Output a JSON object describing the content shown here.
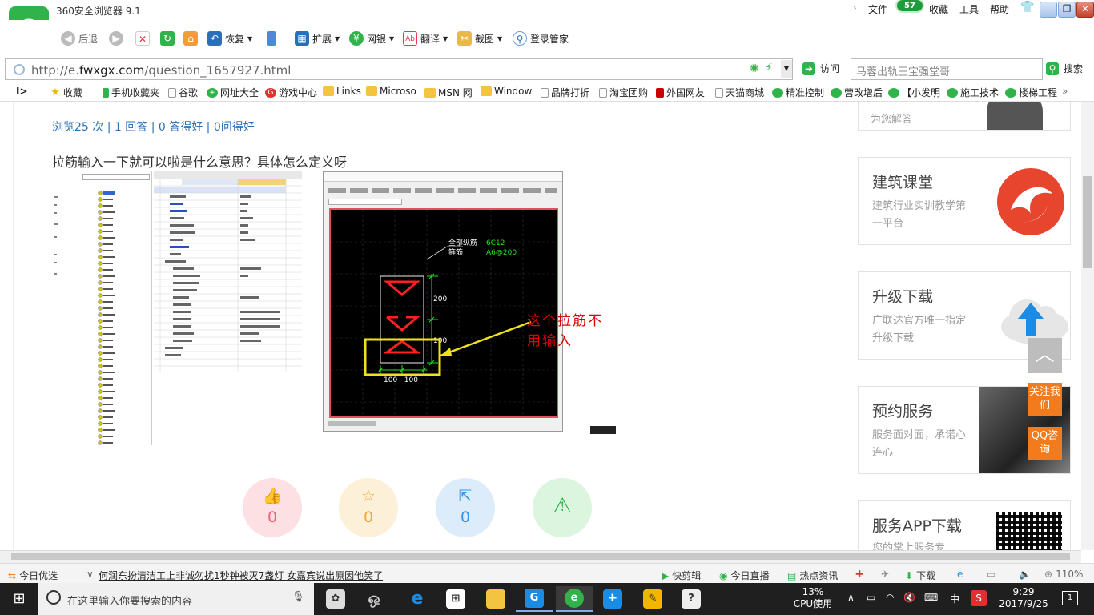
{
  "browser": {
    "title": "360安全浏览器 9.1",
    "menu": {
      "file": "文件",
      "favorites": "收藏",
      "tools": "工具",
      "help": "帮助"
    },
    "badge_count": "57",
    "toolbar": {
      "back": "后退",
      "restore": "恢复",
      "extend": "扩展",
      "netbank": "网银",
      "translate": "翻译",
      "screenshot": "截图",
      "login": "登录管家"
    },
    "address": {
      "url_prefix": "http://e.",
      "url_domain": "fwxgx.com",
      "url_path": "/question_1657927.html",
      "visit": "访问",
      "search_value": "马蓉出轨王宝强堂哥",
      "search_button": "搜索"
    },
    "favbar": [
      {
        "label": "收藏",
        "icon": "star-icon"
      },
      {
        "label": "手机收藏夹",
        "icon": "phone-icon"
      },
      {
        "label": "谷歌",
        "icon": "page-icon"
      },
      {
        "label": "网址大全",
        "icon": "plus-circle-icon"
      },
      {
        "label": "游戏中心",
        "icon": "game-icon"
      },
      {
        "label": "Links",
        "icon": "folder-icon"
      },
      {
        "label": "Microso",
        "icon": "folder-icon"
      },
      {
        "label": "MSN 网",
        "icon": "folder-icon"
      },
      {
        "label": "Window",
        "icon": "folder-icon"
      },
      {
        "label": "品牌打折",
        "icon": "page-icon"
      },
      {
        "label": "淘宝团购",
        "icon": "page-icon"
      },
      {
        "label": "外国网友",
        "icon": "tmall-icon"
      },
      {
        "label": "天猫商城",
        "icon": "page-icon"
      },
      {
        "label": "精准控制",
        "icon": "wechat-icon"
      },
      {
        "label": "营改增后",
        "icon": "wechat-icon"
      },
      {
        "label": "【小发明",
        "icon": "wechat-icon"
      },
      {
        "label": "施工技术",
        "icon": "wechat-icon"
      },
      {
        "label": "楼梯工程",
        "icon": "wechat-icon"
      }
    ]
  },
  "page": {
    "stats": "浏览25 次 | 1 回答 | 0 答得好 | 0问得好",
    "question": "拉筋输入一下就可以啦是什么意思？具体怎么定义呀",
    "annotation": "这个拉筋不用输入",
    "cad_labels": {
      "all_long": "全部纵筋",
      "all_long_val": "6C12",
      "stirrup": "箍筋",
      "stirrup_val": "A6@200",
      "dim_200": "200",
      "dim_100": "100",
      "dim_bottom": "100   100"
    },
    "actions": [
      {
        "name": "like",
        "icon": "thumb-up-icon",
        "count": "0",
        "bg": "#fde0e3",
        "fg": "#f0627a"
      },
      {
        "name": "favorite",
        "icon": "star-icon",
        "count": "0",
        "bg": "#fdf0d9",
        "fg": "#f2a93b"
      },
      {
        "name": "share",
        "icon": "share-icon",
        "count": "0",
        "bg": "#dcecfb",
        "fg": "#3a94e6"
      },
      {
        "name": "report",
        "icon": "warning-icon",
        "count": "",
        "bg": "#dcf5df",
        "fg": "#2fb34a"
      }
    ]
  },
  "sidebar": {
    "top_partial": "为您解答",
    "cards": [
      {
        "title": "建筑课堂",
        "desc": "建筑行业实训教学第一平台"
      },
      {
        "title": "升级下载",
        "desc": "广联达官方唯一指定升级下载"
      },
      {
        "title": "预约服务",
        "desc": "服务面对面，承诺心连心"
      },
      {
        "title": "服务APP下载",
        "desc": "您的掌上服务专"
      }
    ],
    "follow": "关注我们",
    "qq": "QQ咨询"
  },
  "statusbar": {
    "today": "今日优选",
    "news": "何润东扮清洁工上非诚勿扰1秒钟被灭7盏灯 女嘉宾说出原因他笑了",
    "quickclip": "快剪辑",
    "live": "今日直播",
    "hot": "热点资讯",
    "download": "下载",
    "zoom": "110%"
  },
  "taskbar": {
    "search_placeholder": "在这里输入你要搜索的内容",
    "cpu_pct": "13%",
    "cpu_label": "CPU使用",
    "ime": "中",
    "time": "9:29",
    "date": "2017/9/25",
    "notif": "1"
  }
}
